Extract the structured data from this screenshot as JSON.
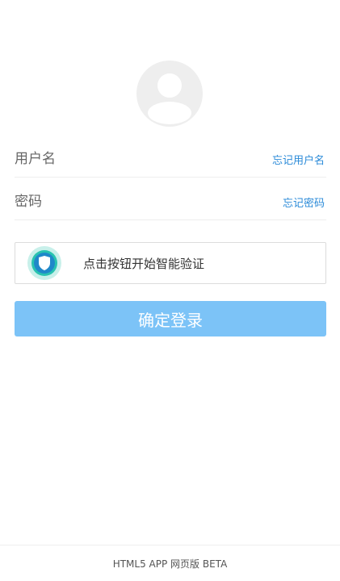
{
  "avatar": {
    "icon": "user-silhouette-icon"
  },
  "form": {
    "username": {
      "placeholder": "用户名",
      "value": "",
      "forgot_link": "忘记用户名"
    },
    "password": {
      "placeholder": "密码",
      "value": "",
      "forgot_link": "忘记密码"
    }
  },
  "captcha": {
    "icon": "shield-icon",
    "label": "点击按钮开始智能验证"
  },
  "login_button": {
    "label": "确定登录"
  },
  "footer": {
    "text": "HTML5 APP 网页版 BETA"
  },
  "colors": {
    "link": "#2a8ad8",
    "button": "#7cc3f7",
    "shield_ring": "#c8f0ea",
    "shield_outer": "#28c3b0",
    "shield_inner": "#1f88c9"
  }
}
